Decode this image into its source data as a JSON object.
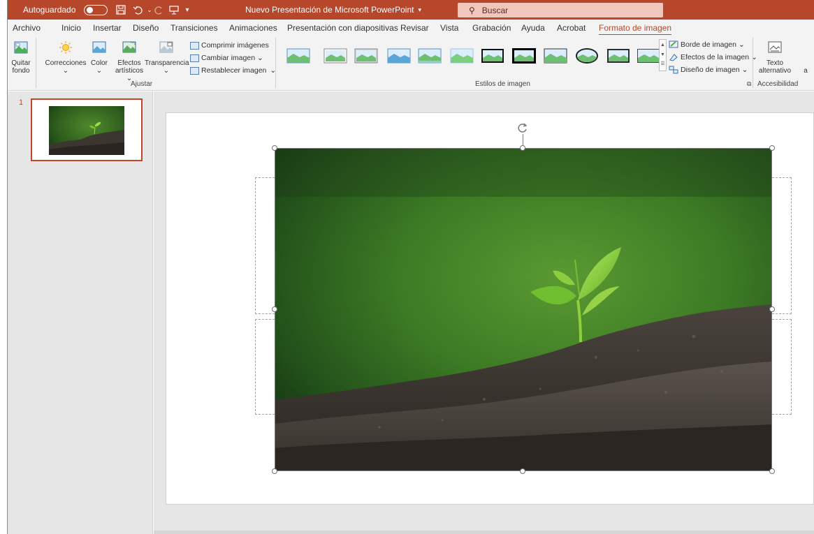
{
  "titlebar": {
    "autosave_label": "Autoguardado",
    "doc_title": "Nuevo Presentación de Microsoft PowerPoint",
    "search_placeholder": "Buscar"
  },
  "tabs": [
    {
      "label": "Archivo"
    },
    {
      "label": "Inicio"
    },
    {
      "label": "Insertar"
    },
    {
      "label": "Diseño"
    },
    {
      "label": "Transiciones"
    },
    {
      "label": "Animaciones"
    },
    {
      "label": "Presentación con diapositivas"
    },
    {
      "label": "Revisar"
    },
    {
      "label": "Vista"
    },
    {
      "label": "Grabación"
    },
    {
      "label": "Ayuda"
    },
    {
      "label": "Acrobat"
    },
    {
      "label": "Formato de imagen"
    }
  ],
  "ribbon": {
    "quitar_fondo_1": "Quitar",
    "quitar_fondo_2": "fondo",
    "correcciones": "Correcciones",
    "color": "Color",
    "efectos_1": "Efectos",
    "efectos_2": "artísticos",
    "transparencia": "Transparencia",
    "comprimir": "Comprimir imágenes",
    "cambiar": "Cambiar imagen",
    "restablecer": "Restablecer imagen",
    "group_ajustar": "Ajustar",
    "group_estilos": "Estilos de imagen",
    "borde": "Borde de imagen",
    "efectos_imagen": "Efectos de la imagen",
    "diseno_imagen": "Diseño de imagen",
    "texto_alt_1": "Texto",
    "texto_alt_2": "alternativo",
    "group_accesibilidad": "Accesibilidad",
    "cut_letter": "a"
  },
  "slides": {
    "current_number": "1"
  },
  "colors": {
    "accent": "#b7472a",
    "ribbon_bg": "#f3f3f3",
    "work_bg": "#e6e6e6"
  }
}
